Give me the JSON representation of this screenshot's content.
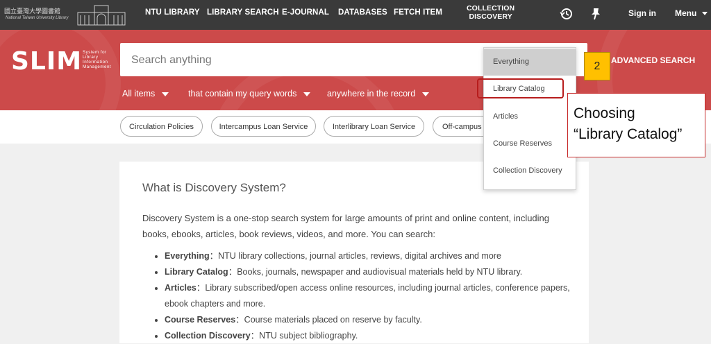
{
  "topnav": {
    "logo_cn": "國立臺灣大學圖書館",
    "logo_en": "National Taiwan University Library",
    "links": [
      "NTU LIBRARY",
      "LIBRARY SEARCH",
      "E-JOURNAL",
      "DATABASES",
      "FETCH ITEM"
    ],
    "collection_line1": "COLLECTION",
    "collection_line2": "DISCOVERY",
    "history_icon": "history-icon",
    "pin_icon": "pin-icon",
    "sign_in": "Sign in",
    "menu": "Menu"
  },
  "brand": {
    "name": "SLIM",
    "sub_lines": [
      "System for",
      "Library",
      "Information",
      "Management"
    ]
  },
  "search": {
    "placeholder": "Search anything",
    "advanced": "ADVANCED SEARCH",
    "filters": [
      "All items",
      "that contain my query words",
      "anywhere in the record"
    ]
  },
  "pills": [
    "Circulation Policies",
    "Intercampus Loan Service",
    "Interlibrary Loan Service",
    "Off-campus I"
  ],
  "dropdown": {
    "items": [
      "Everything",
      "Library Catalog",
      "Articles",
      "Course Reserves",
      "Collection Discovery"
    ],
    "selected": "Everything"
  },
  "content": {
    "title": "What is Discovery System?",
    "intro": "Discovery System is a one-stop search system for large amounts of print and online content, including books, ebooks, articles, book reviews, videos, and more. You can search:",
    "items": [
      {
        "term": "Everything",
        "desc": "NTU library collections, journal articles, reviews, digital archives and more"
      },
      {
        "term": "Library Catalog",
        "desc": "Books, journals, newspaper and audiovisual materials held by NTU library."
      },
      {
        "term": "Articles",
        "desc": "Library subscribed/open access online resources, including journal articles, conference papers, ebook chapters and more."
      },
      {
        "term": "Course Reserves",
        "desc": "Course materials placed on reserve by faculty."
      },
      {
        "term": "Collection Discovery",
        "desc": "NTU subject bibliography."
      }
    ],
    "separator": "："
  },
  "annotation": {
    "step": "2",
    "callout_line1": "Choosing",
    "callout_line2": "“Library Catalog”"
  },
  "colors": {
    "nav_bg": "#3a3a3a",
    "band_red": "#cc4a4a",
    "highlight_red": "#b71c1c",
    "step_yellow": "#ffc000"
  }
}
